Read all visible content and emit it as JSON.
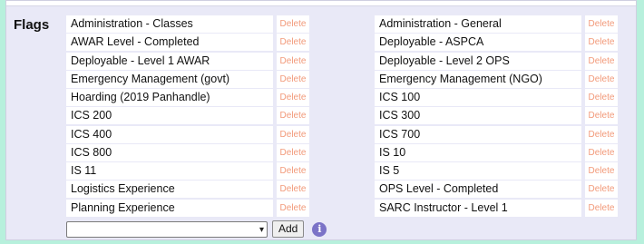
{
  "flags": {
    "label": "Flags",
    "delete_label": "Delete",
    "left_column": [
      "Administration - Classes",
      "AWAR Level - Completed",
      "Deployable - Level 1 AWAR",
      "Emergency Management (govt)",
      "Hoarding (2019 Panhandle)",
      "ICS 200",
      "ICS 400",
      "ICS 800",
      "IS 11",
      "Logistics Experience",
      "Planning Experience"
    ],
    "right_column": [
      "Administration - General",
      "Deployable - ASPCA",
      "Deployable - Level 2 OPS",
      "Emergency Management (NGO)",
      "ICS 100",
      "ICS 300",
      "ICS 700",
      "IS 10",
      "IS 5",
      "OPS Level - Completed",
      "SARC Instructor - Level 1"
    ]
  },
  "add_control": {
    "select_value": "",
    "add_label": "Add",
    "info_glyph": "i"
  },
  "colors": {
    "delete_text": "#f29a7a",
    "panel_bg": "#e9e9f7",
    "page_bg": "#b7f0dc",
    "info_icon": "#7b73c7"
  }
}
